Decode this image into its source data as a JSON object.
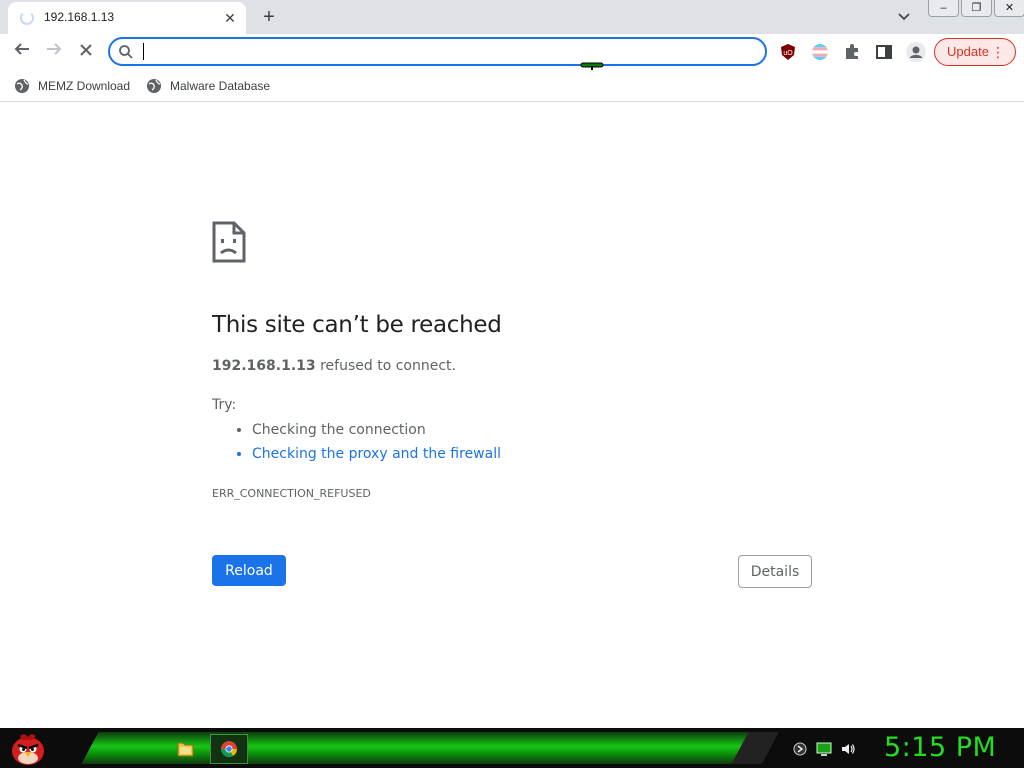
{
  "browser": {
    "tab": {
      "title": "192.168.1.13",
      "close_glyph": "✕"
    },
    "new_tab_glyph": "+",
    "tab_search_glyph": "⌄",
    "window_controls": {
      "minimize": "–",
      "restore": "❐",
      "close": "✕"
    },
    "nav": {
      "back": "←",
      "forward": "→",
      "stop": "✕"
    },
    "omnibox": {
      "value": "",
      "placeholder": ""
    },
    "update_button": {
      "label": "Update",
      "menu_glyph": "⋮"
    },
    "bookmarks": [
      {
        "label": "MEMZ Download",
        "icon": "globe-icon"
      },
      {
        "label": "Malware Database",
        "icon": "globe-icon"
      }
    ],
    "accent_color": "#1a73e8",
    "update_color": "#d93025"
  },
  "error_page": {
    "title": "This site can’t be reached",
    "host": "192.168.1.13",
    "message": " refused to connect.",
    "try_label": "Try:",
    "suggestions": [
      {
        "text": "Checking the connection",
        "is_link": false
      },
      {
        "text": "Checking the proxy and the firewall",
        "is_link": true
      }
    ],
    "error_code": "ERR_CONNECTION_REFUSED",
    "reload_label": "Reload",
    "details_label": "Details"
  },
  "taskbar": {
    "clock": "5:15 PM",
    "apps": [
      "folder-icon",
      "chrome-icon"
    ],
    "tray": [
      "network-icon",
      "monitor-icon",
      "speaker-icon"
    ],
    "accent_color": "#22dd22"
  }
}
